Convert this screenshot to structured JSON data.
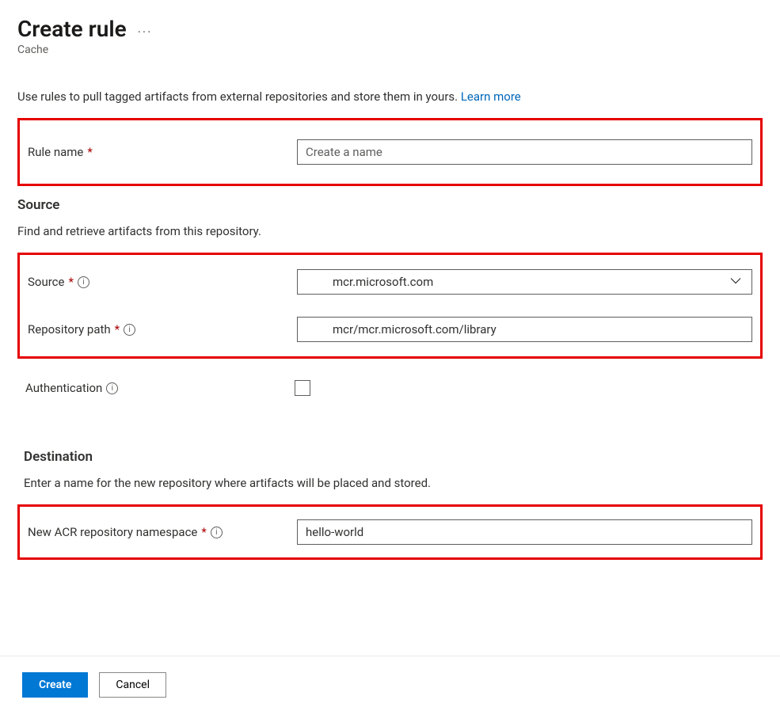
{
  "header": {
    "title": "Create rule",
    "subtitle": "Cache"
  },
  "intro": {
    "text": "Use rules to pull tagged artifacts from external repositories and store them in yours. ",
    "link_text": "Learn more"
  },
  "fields": {
    "rule_name": {
      "label": "Rule name",
      "placeholder": "Create a name",
      "value": ""
    }
  },
  "source": {
    "heading": "Source",
    "desc": "Find and retrieve artifacts from this repository.",
    "source_field": {
      "label": "Source",
      "value": "mcr.microsoft.com"
    },
    "repo_path": {
      "label": "Repository path",
      "value": "mcr/mcr.microsoft.com/library"
    },
    "auth": {
      "label": "Authentication",
      "checked": false
    }
  },
  "destination": {
    "heading": "Destination",
    "desc": "Enter a name for the new repository where artifacts will be placed and stored.",
    "namespace": {
      "label": "New ACR repository namespace",
      "value": "hello-world"
    }
  },
  "footer": {
    "create": "Create",
    "cancel": "Cancel"
  }
}
